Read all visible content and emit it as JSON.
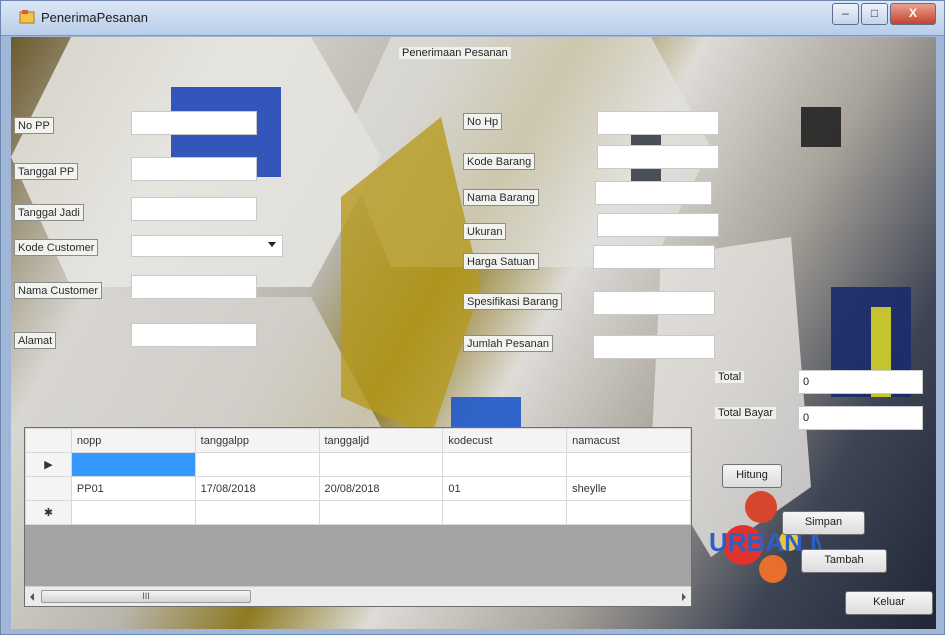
{
  "window": {
    "title": "PenerimaPesanan",
    "min_label": "–",
    "max_label": "□",
    "close_label": "X"
  },
  "form": {
    "caption": "Penerimaan Pesanan",
    "left_fields": {
      "no_pp": {
        "label": "No PP",
        "value": ""
      },
      "tanggal_pp": {
        "label": "Tanggal PP",
        "value": ""
      },
      "tanggal_jadi": {
        "label": "Tanggal Jadi",
        "value": ""
      },
      "kode_customer": {
        "label": "Kode Customer",
        "value": ""
      },
      "nama_customer": {
        "label": "Nama Customer",
        "value": ""
      },
      "alamat": {
        "label": "Alamat",
        "value": ""
      }
    },
    "right_fields": {
      "no_hp": {
        "label": "No Hp",
        "value": ""
      },
      "kode_barang": {
        "label": "Kode Barang",
        "value": ""
      },
      "nama_barang": {
        "label": "Nama Barang",
        "value": ""
      },
      "ukuran": {
        "label": "Ukuran",
        "value": ""
      },
      "harga_satuan": {
        "label": "Harga Satuan",
        "value": ""
      },
      "spesifikasi_barang": {
        "label": "Spesifikasi Barang",
        "value": ""
      },
      "jumlah_pesanan": {
        "label": "Jumlah Pesanan",
        "value": ""
      }
    },
    "totals": {
      "total": {
        "label": "Total",
        "value": "0"
      },
      "total_bayar": {
        "label": "Total Bayar",
        "value": "0"
      }
    }
  },
  "buttons": {
    "hitung": "Hitung",
    "simpan": "Simpan",
    "tambah": "Tambah",
    "keluar": "Keluar"
  },
  "grid": {
    "columns": [
      "nopp",
      "tanggalpp",
      "tanggaljd",
      "kodecust",
      "namacust"
    ],
    "rows": [
      {
        "marker": "▶",
        "cells": [
          "",
          "",
          "",
          "",
          ""
        ]
      },
      {
        "marker": "",
        "cells": [
          "PP01",
          "17/08/2018",
          "20/08/2018",
          "01",
          "sheylle"
        ]
      },
      {
        "marker": "✱",
        "cells": [
          "",
          "",
          "",
          "",
          ""
        ]
      }
    ],
    "scroll_thumb_label": "III"
  },
  "logo": {
    "text": "URBAN MC"
  },
  "colors": {
    "selection": "#3399ff",
    "title_gradient_top": "#dbe7f6",
    "close_button": "#c4422c"
  }
}
